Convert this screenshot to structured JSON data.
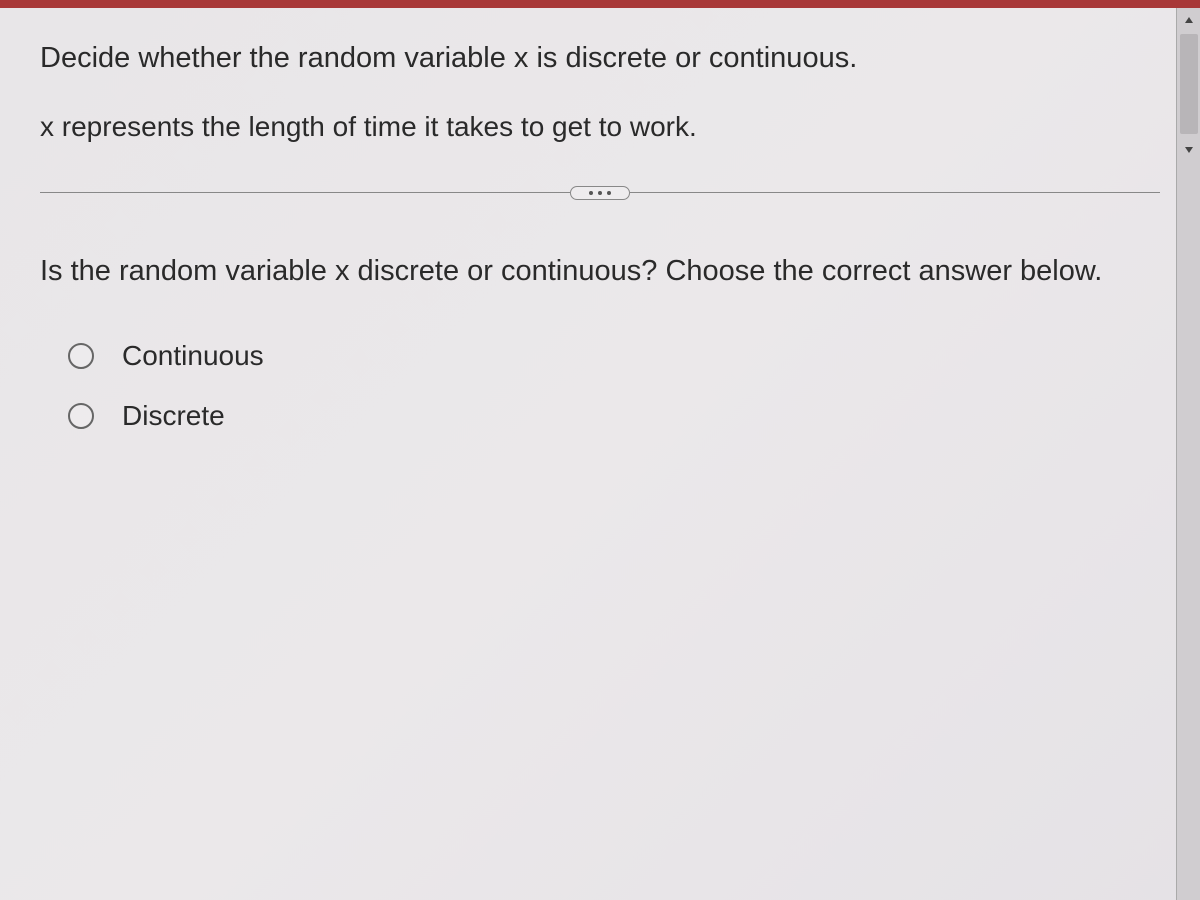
{
  "question": {
    "prompt": "Decide whether the random variable x is discrete or continuous.",
    "context": "x represents the length of time it takes to get to work.",
    "instruction": "Is the random variable x discrete or continuous? Choose the correct answer below."
  },
  "options": [
    {
      "label": "Continuous"
    },
    {
      "label": "Discrete"
    }
  ]
}
